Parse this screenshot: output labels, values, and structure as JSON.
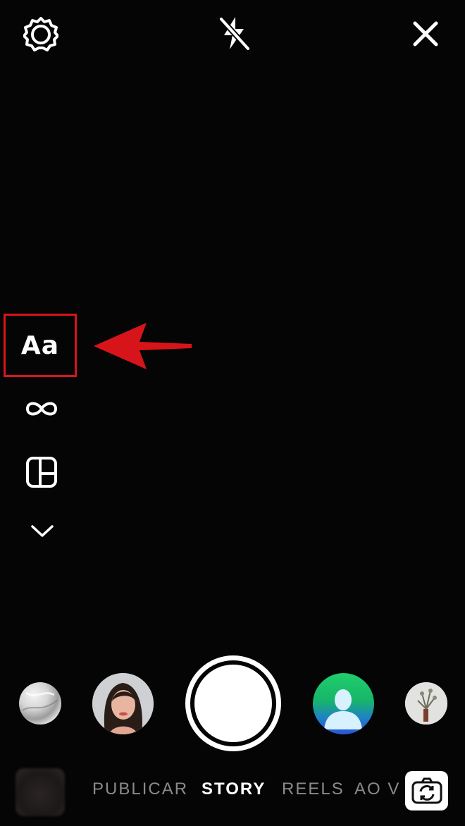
{
  "top_bar": {
    "settings_icon": "gear-icon",
    "flash_icon": "flash-off-icon",
    "close_icon": "close-icon"
  },
  "side_tools": {
    "text_label": "Aa",
    "boomerang_icon": "infinity-icon",
    "layout_icon": "layout-grid-icon",
    "more_icon": "chevron-down-icon"
  },
  "annotation": {
    "color": "#d8141b"
  },
  "effects": {
    "items": [
      "marble-effect",
      "portrait-effect",
      "green-screen-effect",
      "plant-effect"
    ]
  },
  "modes": {
    "items": [
      "PUBLICAR",
      "STORY",
      "REELS",
      "AO V"
    ],
    "active": "STORY"
  },
  "flip_camera_icon": "flip-camera-icon"
}
